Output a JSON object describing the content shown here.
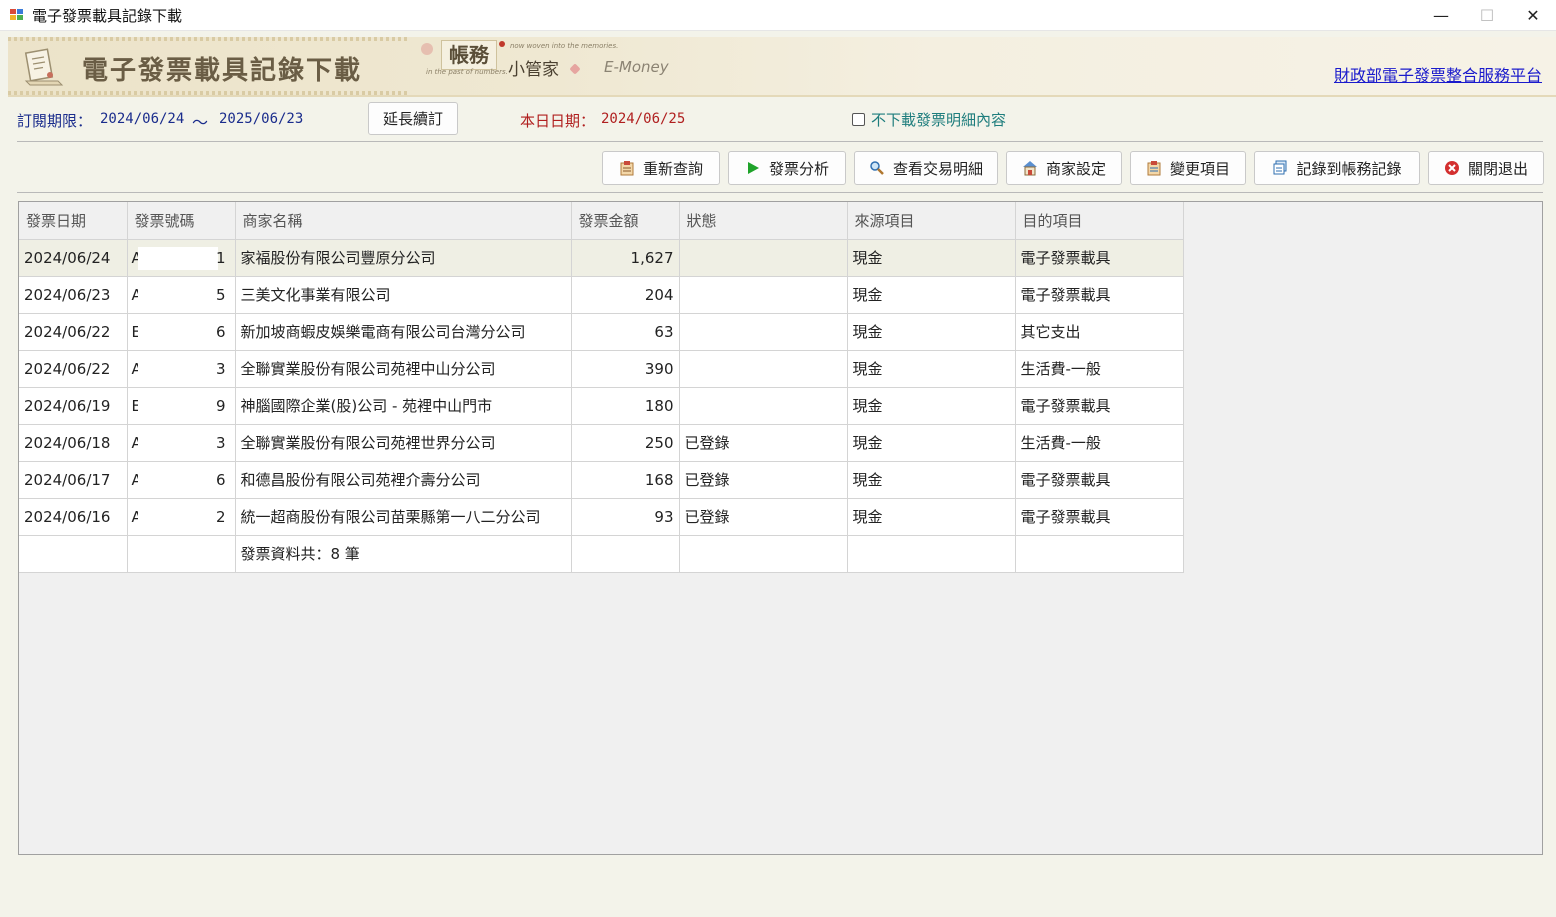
{
  "window": {
    "title": "電子發票載具記錄下載",
    "minimize": "—",
    "maximize": "☐",
    "close": "✕"
  },
  "banner": {
    "title": "電子發票載具記錄下載",
    "brand_main": "帳務",
    "brand_sub": "小管家",
    "brand_tag1": "now woven into the memories.",
    "brand_tag2": "in the past of numbers.",
    "brand_emoney": "E-Money",
    "gov_link": "財政部電子發票整合服務平台"
  },
  "subscription": {
    "label": "訂閱期限：",
    "start": "2024/06/24",
    "tilde": "〜",
    "end": "2025/06/23",
    "extend_button": "延長續訂",
    "today_label": "本日日期：",
    "today_value": "2024/06/25",
    "no_detail_checkbox": "不下載發票明細內容",
    "no_detail_checked": false
  },
  "toolbar": {
    "requery": "重新查詢",
    "analyze": "發票分析",
    "view_detail": "查看交易明細",
    "merchant_settings": "商家設定",
    "change_item": "變更項目",
    "record_to_ledger": "記錄到帳務記錄",
    "close_exit": "關閉退出"
  },
  "grid": {
    "columns": [
      "發票日期",
      "發票號碼",
      "商家名稱",
      "發票金額",
      "狀態",
      "來源項目",
      "目的項目"
    ],
    "rows": [
      {
        "date": "2024/06/24",
        "inv_prefix": "A",
        "inv_suffix": "1",
        "merchant": "家福股份有限公司豐原分公司",
        "amount": "1,627",
        "status": "",
        "source": "現金",
        "target": "電子發票載具"
      },
      {
        "date": "2024/06/23",
        "inv_prefix": "A",
        "inv_suffix": "5",
        "merchant": "三美文化事業有限公司",
        "amount": "204",
        "status": "",
        "source": "現金",
        "target": "電子發票載具"
      },
      {
        "date": "2024/06/22",
        "inv_prefix": "E",
        "inv_suffix": "6",
        "merchant": "新加坡商蝦皮娛樂電商有限公司台灣分公司",
        "amount": "63",
        "status": "",
        "source": "現金",
        "target": "其它支出"
      },
      {
        "date": "2024/06/22",
        "inv_prefix": "A",
        "inv_suffix": "3",
        "merchant": "全聯實業股份有限公司苑裡中山分公司",
        "amount": "390",
        "status": "",
        "source": "現金",
        "target": "生活費-一般"
      },
      {
        "date": "2024/06/19",
        "inv_prefix": "E",
        "inv_suffix": "9",
        "merchant": "神腦國際企業(股)公司 - 苑裡中山門市",
        "amount": "180",
        "status": "",
        "source": "現金",
        "target": "電子發票載具"
      },
      {
        "date": "2024/06/18",
        "inv_prefix": "A",
        "inv_suffix": "3",
        "merchant": "全聯實業股份有限公司苑裡世界分公司",
        "amount": "250",
        "status": "已登錄",
        "source": "現金",
        "target": "生活費-一般"
      },
      {
        "date": "2024/06/17",
        "inv_prefix": "A",
        "inv_suffix": "6",
        "merchant": "和德昌股份有限公司苑裡介壽分公司",
        "amount": "168",
        "status": "已登錄",
        "source": "現金",
        "target": "電子發票載具"
      },
      {
        "date": "2024/06/16",
        "inv_prefix": "A",
        "inv_suffix": "2",
        "merchant": "統一超商股份有限公司苗栗縣第一八二分公司",
        "amount": "93",
        "status": "已登錄",
        "source": "現金",
        "target": "電子發票載具"
      }
    ],
    "summary": "發票資料共：8 筆"
  }
}
